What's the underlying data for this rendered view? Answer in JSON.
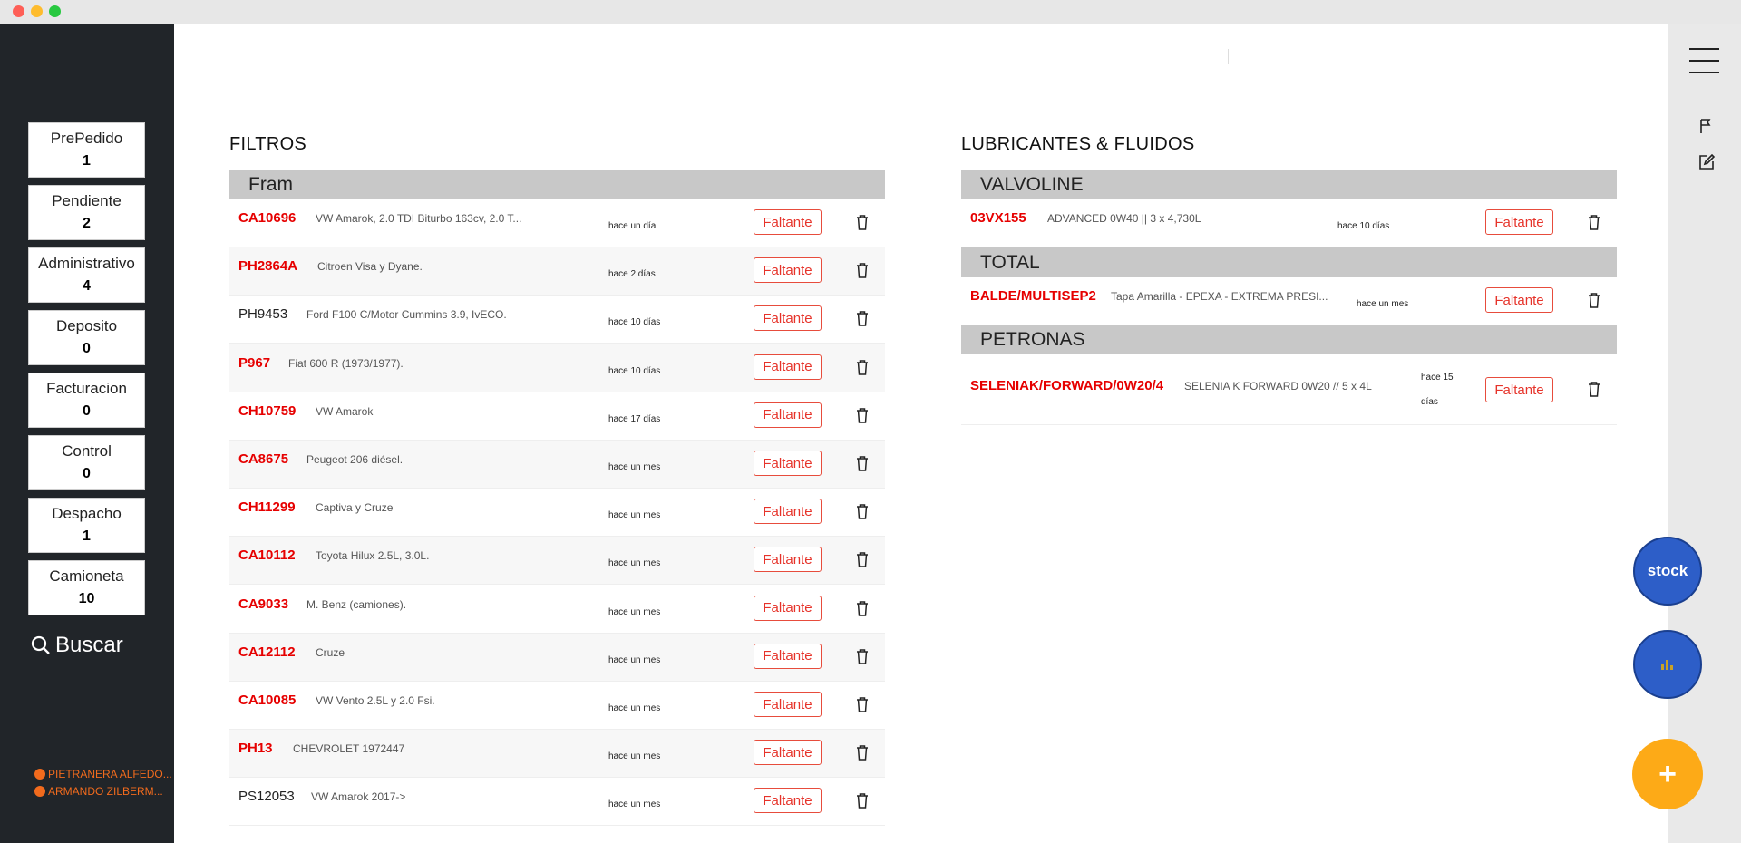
{
  "window": {
    "controls": [
      "close",
      "minimize",
      "maximize"
    ]
  },
  "sidebar": {
    "statuses": [
      {
        "label": "PrePedido",
        "count": "1"
      },
      {
        "label": "Pendiente",
        "count": "2"
      },
      {
        "label": "Administrativo",
        "count": "4"
      },
      {
        "label": "Deposito",
        "count": "0"
      },
      {
        "label": "Facturacion",
        "count": "0"
      },
      {
        "label": "Control",
        "count": "0"
      },
      {
        "label": "Despacho",
        "count": "1"
      },
      {
        "label": "Camioneta",
        "count": "10"
      }
    ],
    "search_label": "Buscar",
    "users": [
      "PIETRANERA ALFEDO...",
      "ARMANDO ZILBERM..."
    ],
    "user_dot_color": "#f26b1d"
  },
  "filtros": {
    "title": "FILTROS",
    "groups": [
      {
        "name": "Fram",
        "items": [
          {
            "code": "CA10696",
            "desc": "VW Amarok, 2.0 TDI Biturbo 163cv, 2.0 T...",
            "time": "hace un día",
            "action": "Faltante"
          },
          {
            "code": "PH2864A",
            "desc": "Citroen Visa y Dyane.",
            "time": "hace 2 días",
            "action": "Faltante"
          },
          {
            "code": "PH9453",
            "desc": "Ford F100 C/Motor Cummins 3.9, IvECO.",
            "time": "hace 10 días",
            "action": "Faltante"
          },
          {
            "code": "P967",
            "desc": "Fiat 600 R (1973/1977).",
            "time": "hace 10 días",
            "action": "Faltante"
          },
          {
            "code": "CH10759",
            "desc": "VW Amarok",
            "time": "hace 17 días",
            "action": "Faltante"
          },
          {
            "code": "CA8675",
            "desc": "Peugeot 206 diésel.",
            "time": "hace un mes",
            "action": "Faltante"
          },
          {
            "code": "CH11299",
            "desc": "Captiva y Cruze",
            "time": "hace un mes",
            "action": "Faltante"
          },
          {
            "code": "CA10112",
            "desc": "Toyota Hilux 2.5L, 3.0L.",
            "time": "hace un mes",
            "action": "Faltante"
          },
          {
            "code": "CA9033",
            "desc": "M. Benz (camiones).",
            "time": "hace un mes",
            "action": "Faltante"
          },
          {
            "code": "CA12112",
            "desc": "Cruze",
            "time": "hace un mes",
            "action": "Faltante"
          },
          {
            "code": "CA10085",
            "desc": "VW Vento 2.5L y 2.0 Fsi.",
            "time": "hace un mes",
            "action": "Faltante"
          },
          {
            "code": "PH13",
            "desc": "CHEVROLET 1972447",
            "time": "hace un mes",
            "action": "Faltante"
          },
          {
            "code": "PS12053",
            "desc": "VW Amarok 2017->",
            "time": "hace un mes",
            "action": "Faltante"
          }
        ]
      }
    ]
  },
  "lubricantes": {
    "title": "LUBRICANTES & FLUIDOS",
    "groups": [
      {
        "name": "VALVOLINE",
        "items": [
          {
            "code": "03VX155",
            "desc": "ADVANCED 0W40 || 3 x 4,730L",
            "time": "hace 10 días",
            "action": "Faltante"
          }
        ]
      },
      {
        "name": "TOTAL",
        "items": [
          {
            "code": "BALDE/MULTISEP2",
            "desc": "Tapa Amarilla - EPEXA - EXTREMA PRESI...",
            "time": "hace un mes",
            "action": "Faltante"
          }
        ]
      },
      {
        "name": "PETRONAS",
        "items": [
          {
            "code": "SELENIAK/FORWARD/0W20/4",
            "desc": "SELENIA K FORWARD 0W20 // 5 x 4L",
            "time_line1": "hace 15",
            "time_line2": "días",
            "action": "Faltante"
          }
        ]
      }
    ]
  },
  "fabs": {
    "stock_label": "stock",
    "add_label": "+"
  },
  "colors": {
    "sidebar_bg": "#212529",
    "accent_red": "#e60000",
    "stock_blue": "#2d5ec8",
    "add_orange": "#fdaa17"
  }
}
